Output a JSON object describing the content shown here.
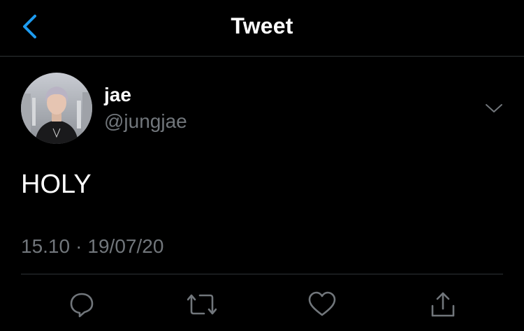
{
  "nav": {
    "title": "Tweet",
    "back_icon": "chevron-left-icon"
  },
  "author": {
    "name": "jae",
    "handle": "@jungjae"
  },
  "tweet": {
    "text": "HOLY",
    "time": "15.10",
    "separator": "·",
    "date": "19/07/20"
  },
  "actions": [
    {
      "name": "reply",
      "icon": "reply-icon"
    },
    {
      "name": "retweet",
      "icon": "retweet-icon"
    },
    {
      "name": "like",
      "icon": "heart-icon"
    },
    {
      "name": "share",
      "icon": "share-icon"
    }
  ],
  "colors": {
    "background": "#000000",
    "accent": "#1d9bf0",
    "text_primary": "#ffffff",
    "text_secondary": "#71767b",
    "divider": "#2f3336"
  }
}
